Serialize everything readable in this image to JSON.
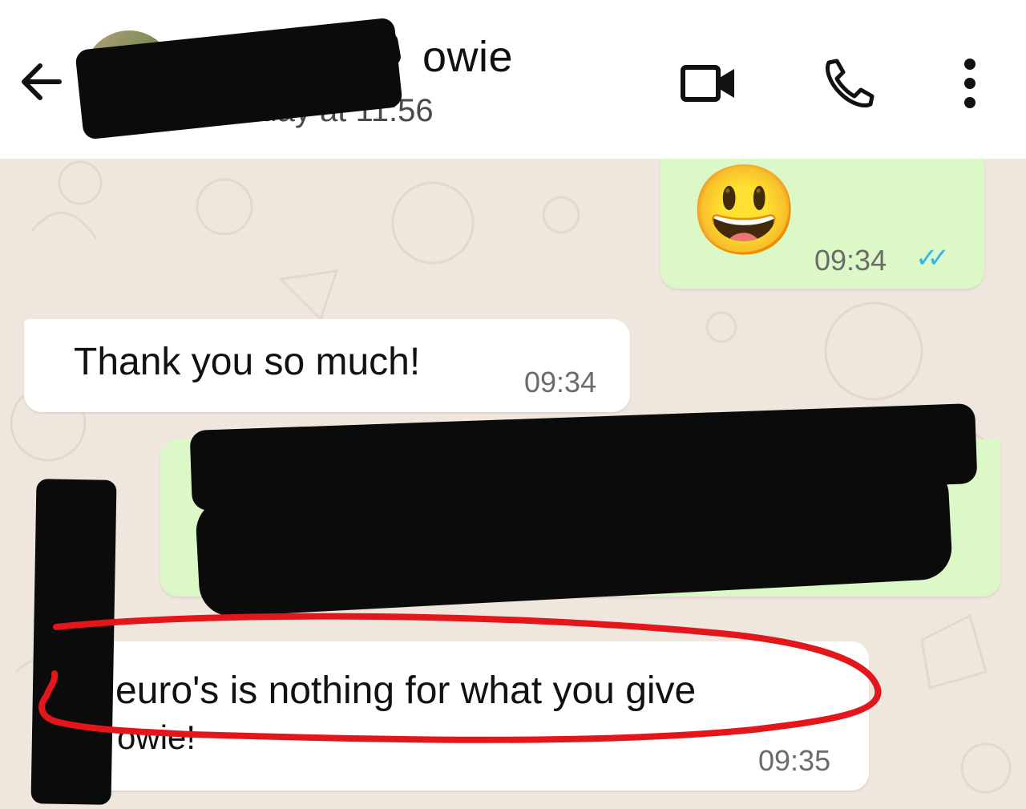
{
  "header": {
    "title": "owie",
    "status": "st seen today at 11:56"
  },
  "messages": [
    {
      "direction": "outgoing",
      "text": "😃",
      "time": "09:34",
      "ticks": "✓✓"
    },
    {
      "direction": "incoming",
      "text": "Thank you so much!",
      "time": "09:34"
    },
    {
      "direction": "outgoing",
      "text": "",
      "time": ""
    },
    {
      "direction": "incoming",
      "line1": "euro's is nothing for what you give",
      "line2": "owie!",
      "time": "09:35"
    }
  ],
  "colors": {
    "outgoing_bubble": "#dcf8c6",
    "incoming_bubble": "#ffffff",
    "read_ticks": "#34b7f1",
    "annotation": "#e3161b",
    "wallpaper": "#efe7dd"
  }
}
